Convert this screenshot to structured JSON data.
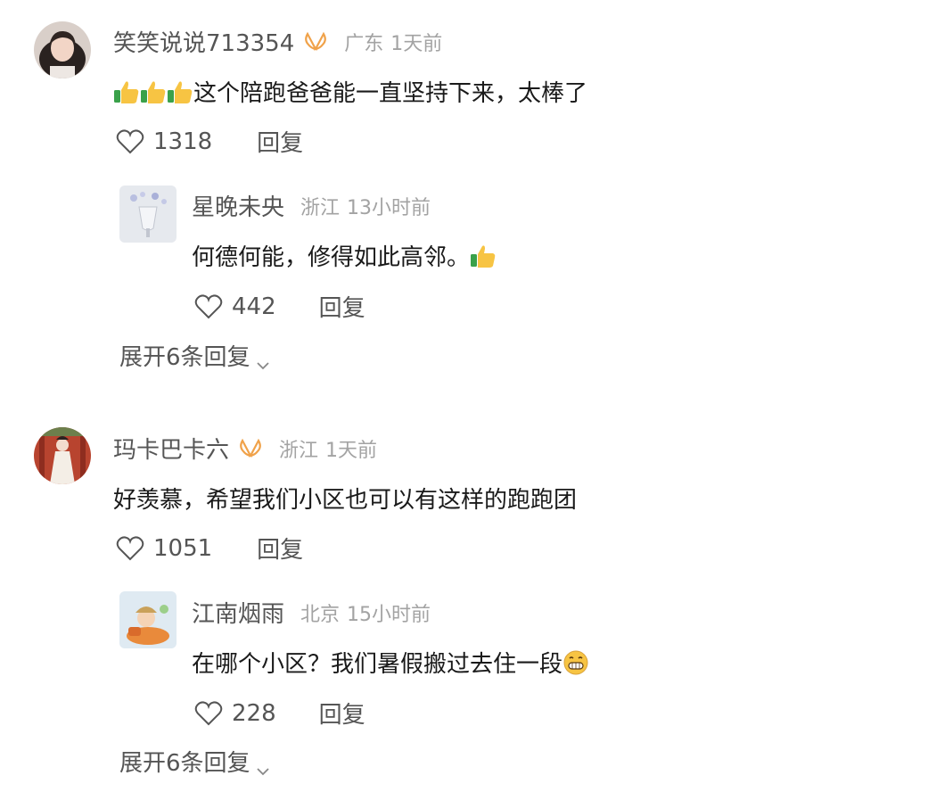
{
  "comments": [
    {
      "user": "笑笑说说713354",
      "has_badge": true,
      "location": "广东",
      "time": "1天前",
      "text": "这个陪跑爸爸能一直坚持下来，太棒了",
      "leading_emojis": [
        "thumbs-up",
        "thumbs-up",
        "thumbs-up"
      ],
      "likes": "1318",
      "reply_label": "回复",
      "reply": {
        "user": "星晚未央",
        "location": "浙江",
        "time": "13小时前",
        "text": "何德何能，修得如此高邻。",
        "trailing_emoji": "thumbs-up",
        "likes": "442",
        "reply_label": "回复"
      },
      "expand_label": "展开6条回复"
    },
    {
      "user": "玛卡巴卡六",
      "has_badge": true,
      "location": "浙江",
      "time": "1天前",
      "text": "好羡慕，希望我们小区也可以有这样的跑跑团",
      "likes": "1051",
      "reply_label": "回复",
      "reply": {
        "user": "江南烟雨",
        "location": "北京",
        "time": "15小时前",
        "text": "在哪个小区？我们暑假搬过去住一段",
        "trailing_emoji": "grinning-face",
        "likes": "228",
        "reply_label": "回复"
      },
      "expand_label": "展开6条回复"
    }
  ],
  "colors": {
    "badge": "#f0a24a",
    "muted": "#a3a3a3",
    "secondary": "#555555",
    "text": "#1a1a1a"
  }
}
